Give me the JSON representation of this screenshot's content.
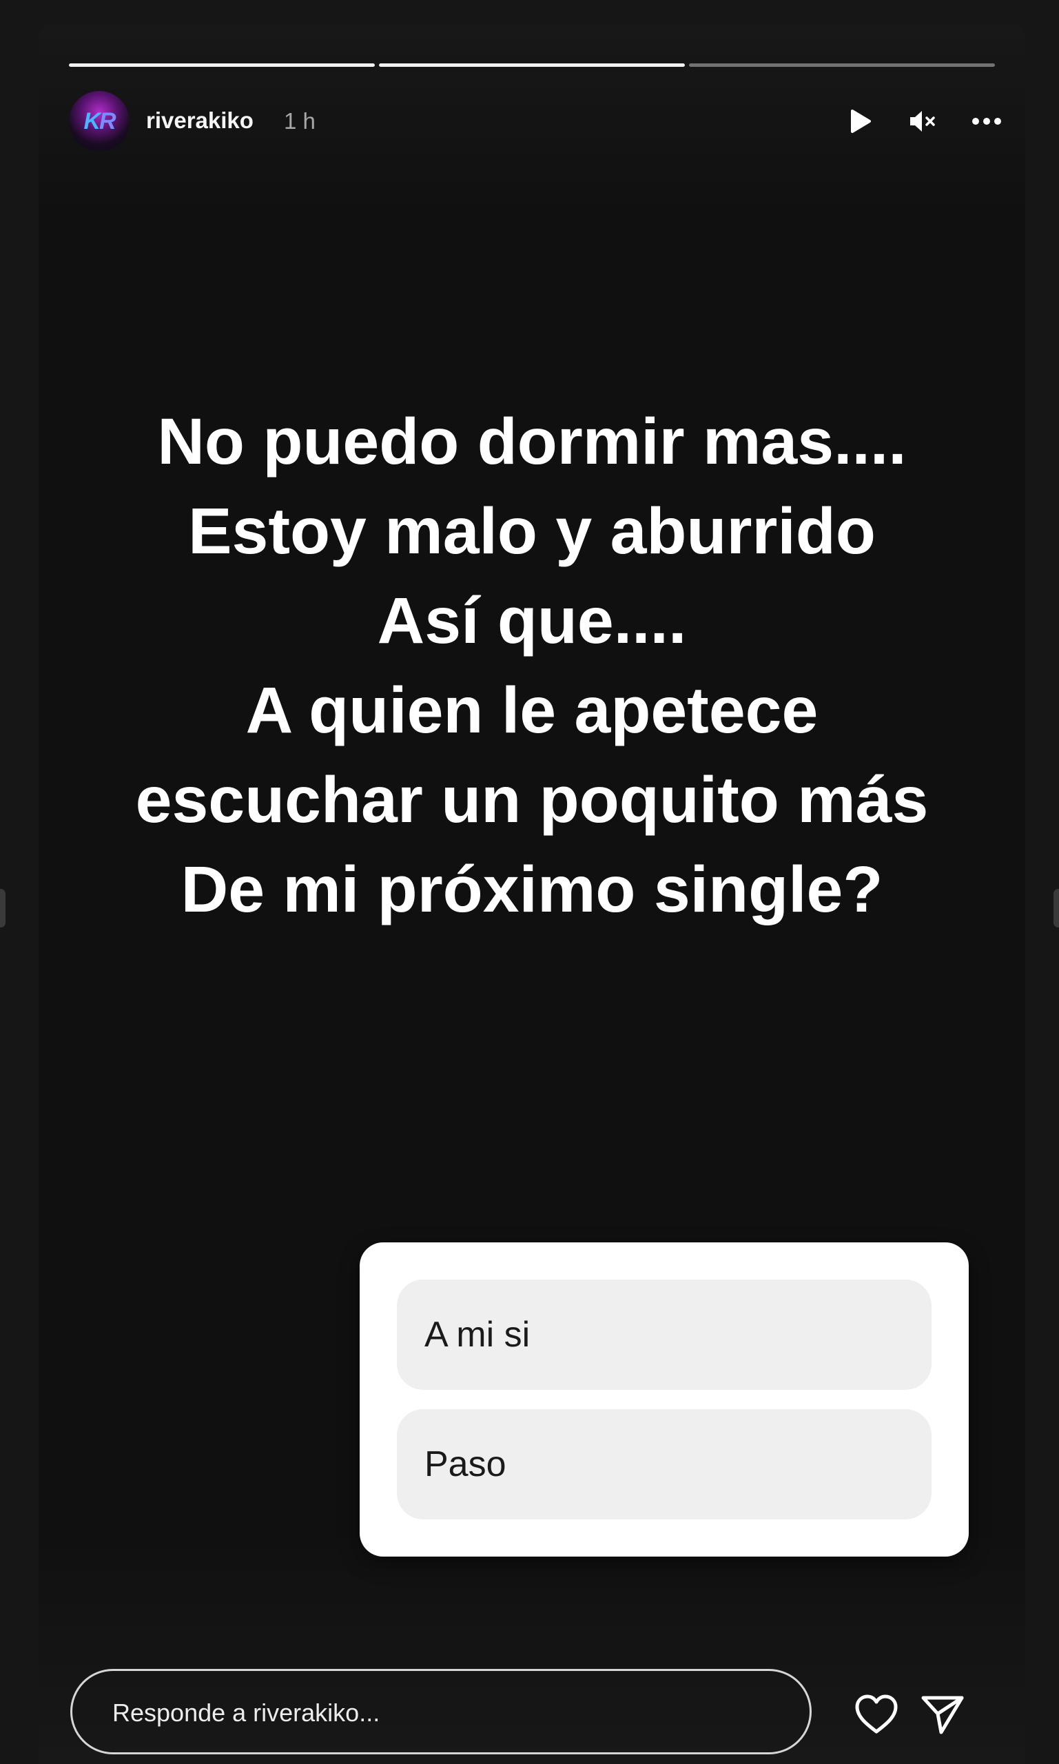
{
  "progress": [
    {
      "label": "segment 1",
      "fill": 1.0
    },
    {
      "label": "segment 2",
      "fill": 1.0
    },
    {
      "label": "segment 3",
      "fill": 0.0
    }
  ],
  "header": {
    "username": "riverakiko",
    "time": "1 h",
    "avatar_icon": "kr-logo-avatar",
    "play_icon": "play-icon",
    "mute_icon": "muted-speaker-icon",
    "more_icon": "more-dots-icon"
  },
  "story": {
    "lines": [
      "No puedo dormir mas....",
      "Estoy malo y aburrido",
      "Así que....",
      "A quien le apetece",
      "escuchar un poquito más",
      "De mi próximo single?"
    ]
  },
  "poll": {
    "options": [
      "A mi si",
      "Paso"
    ]
  },
  "reply": {
    "placeholder": "Responde a riverakiko...",
    "like_icon": "heart-icon",
    "send_icon": "send-icon"
  },
  "colors": {
    "background": "#161616",
    "story_bg": "#101010",
    "text": "#ffffff",
    "poll_bg": "#ffffff",
    "poll_option_bg": "#efefef"
  }
}
